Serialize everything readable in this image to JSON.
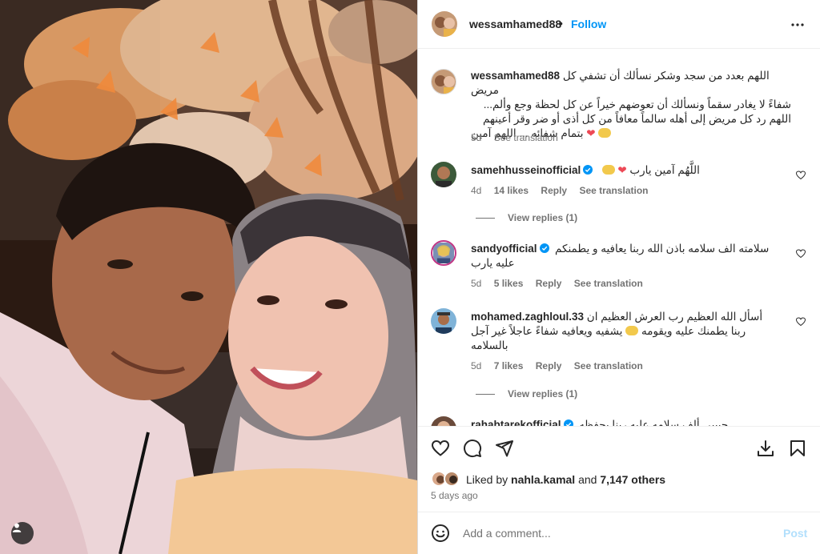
{
  "post": {
    "username": "wessamhamed88",
    "separator": "•",
    "follow_label": "Follow",
    "more_icon": "more-horizontal-icon"
  },
  "caption": {
    "username": "wessamhamed88",
    "lines": [
      "اللهم بعدد من سجد وشكر نسألك أن تشفي كل مريض",
      "شفاءً لا يغادر سقماً ونسألك أن تعوضهم خيراً عن كل لحظة وجع وألم...",
      "اللهم رد كل مريض إلى أهله سالماً معافاً من كل أذى أو ضر وقر أعينهم",
      "بتمام شفائه ... اللهم آمين"
    ],
    "time": "5d",
    "see_translation": "See translation"
  },
  "comments": [
    {
      "username": "samehhusseinofficial",
      "verified": true,
      "lines": [
        "اللَّهُم آمين يارب"
      ],
      "time": "4d",
      "likes": "14 likes",
      "reply": "Reply",
      "see_translation": "See translation",
      "view_replies": "View replies (1)"
    },
    {
      "username": "sandyofficial",
      "verified": true,
      "lines": [
        "سلامته الف سلامه باذن الله ربنا يعافيه و يطمنكم",
        "عليه يارب"
      ],
      "time": "5d",
      "likes": "5 likes",
      "reply": "Reply",
      "see_translation": "See translation"
    },
    {
      "username": "mohamed.zaghloul.33",
      "verified": false,
      "lines": [
        "أسأل الله العظيم رب العرش العظيم ان",
        "يشفيه ويعافيه شفاءً عاجلاً غير آجل",
        "ربنا يطمنك عليه ويقومه",
        "بالسلامه"
      ],
      "time": "5d",
      "likes": "7 likes",
      "reply": "Reply",
      "see_translation": "See translation",
      "view_replies": "View replies (1)"
    },
    {
      "username": "rahabtarekofficial",
      "verified": true,
      "lines": [
        "حبيبي ألف سلامه عليه ربنا يحفظه"
      ]
    }
  ],
  "actions": {
    "like_icon": "heart-icon",
    "comment_icon": "comment-icon",
    "share_icon": "share-icon",
    "save_icon": "bookmark-icon",
    "download_icon": "download-icon"
  },
  "likes": {
    "prefix": "Liked by",
    "user": "nahla.kamal",
    "and": "and",
    "others": "7,147 others"
  },
  "time_ago": "5 days ago",
  "add_comment": {
    "placeholder": "Add a comment...",
    "post_label": "Post"
  },
  "colors": {
    "accent": "#0095f6",
    "post_disabled": "#b2dffc",
    "heart": "#ed4956",
    "muted": "#737373"
  }
}
